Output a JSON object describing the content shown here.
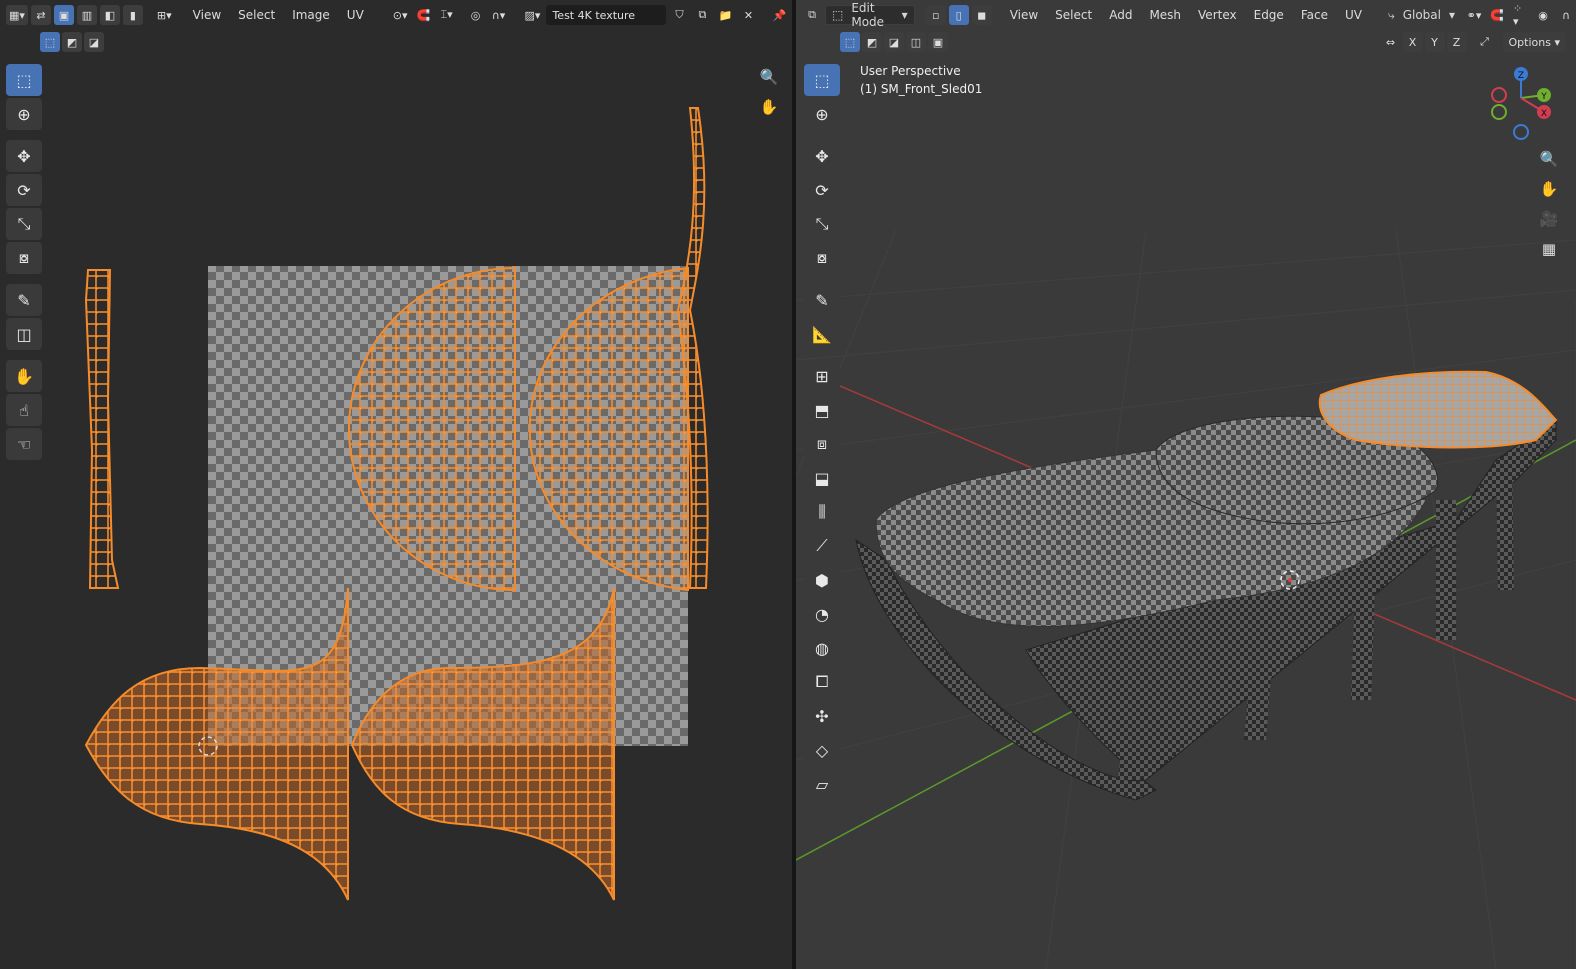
{
  "uv_editor": {
    "menus": [
      "View",
      "Select",
      "Image",
      "UV"
    ],
    "image_name": "Test 4K texture",
    "icons": {
      "editor_type": "uv-editor-icon",
      "sync": "uv-sync-icon",
      "pivot": "pivot-icon",
      "snap": "snap-icon",
      "proportional": "proportional-edit-icon",
      "image_browse": "image-browse-icon",
      "pin": "pin-icon"
    },
    "tools": [
      "select-box",
      "cursor",
      "move",
      "rotate",
      "scale",
      "transform",
      "annotate",
      "rip-region",
      "grab",
      "relax",
      "pinch"
    ]
  },
  "viewport": {
    "mode": "Edit Mode",
    "menus": [
      "View",
      "Select",
      "Add",
      "Mesh",
      "Vertex",
      "Edge",
      "Face",
      "UV"
    ],
    "transform_orientation": "Global",
    "axis_buttons": [
      "X",
      "Y",
      "Z"
    ],
    "options_label": "Options",
    "overlay_line1": "User Perspective",
    "overlay_line2": "(1) SM_Front_Sled01",
    "gizmo_labels": [
      "Z",
      "Y",
      "X"
    ],
    "tools": [
      "select-box",
      "cursor",
      "move",
      "rotate",
      "scale",
      "transform",
      "annotate",
      "measure",
      "add-cube",
      "extrude",
      "inset",
      "bevel",
      "loop-cut",
      "knife",
      "poly-build",
      "spin",
      "smooth",
      "edge-slide",
      "shrink-fatten",
      "shear",
      "rip"
    ]
  },
  "colors": {
    "accent": "#4772b3",
    "selection": "#f58b2a",
    "header_bg": "#2b2b2b",
    "uv_bg": "#2b2b2b",
    "viewport_bg": "#3a3a3a"
  }
}
